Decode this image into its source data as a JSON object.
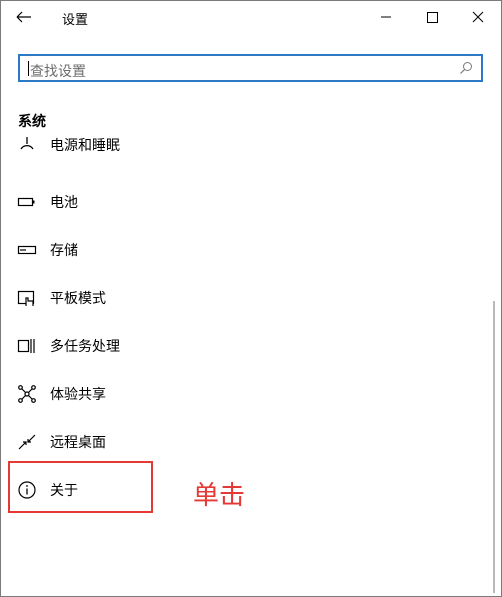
{
  "window": {
    "title": "设置"
  },
  "search": {
    "placeholder": "查找设置"
  },
  "section": {
    "title": "系统"
  },
  "items": [
    {
      "label": "电源和睡眠",
      "icon": "power-icon"
    },
    {
      "label": "电池",
      "icon": "battery-icon"
    },
    {
      "label": "存储",
      "icon": "storage-icon"
    },
    {
      "label": "平板模式",
      "icon": "tablet-mode-icon"
    },
    {
      "label": "多任务处理",
      "icon": "multitasking-icon"
    },
    {
      "label": "体验共享",
      "icon": "shared-experiences-icon"
    },
    {
      "label": "远程桌面",
      "icon": "remote-desktop-icon"
    },
    {
      "label": "关于",
      "icon": "info-icon"
    }
  ],
  "annotation": {
    "text": "单击",
    "color": "#e53935"
  },
  "colors": {
    "accent": "#2b78c5",
    "highlight": "#e53935"
  }
}
